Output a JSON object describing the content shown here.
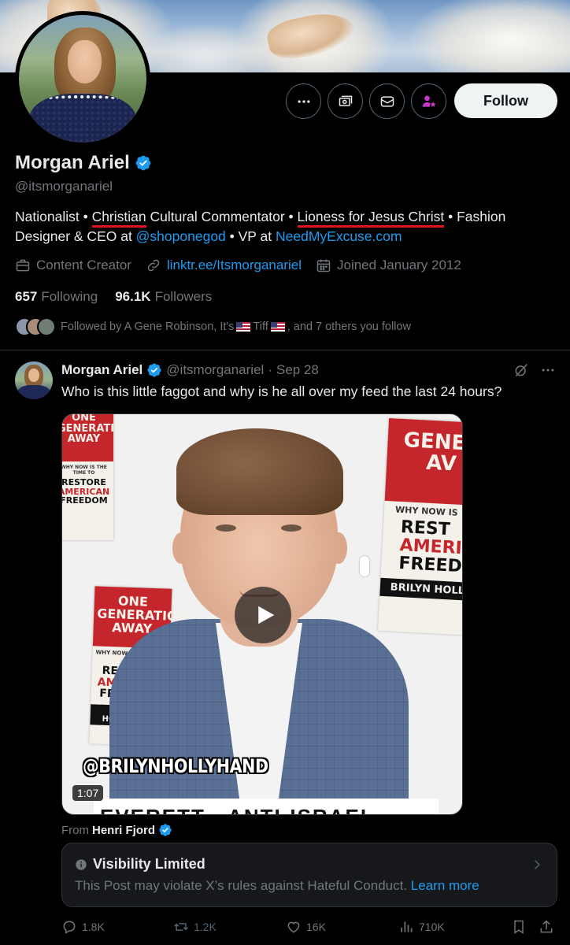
{
  "profile": {
    "display_name": "Morgan Ariel",
    "handle": "@itsmorganariel",
    "follow_label": "Follow",
    "bio": {
      "p1": "Nationalist • ",
      "p2": "Christian",
      "p3": " Cultural Commentator • ",
      "p4": "Lioness for Jesus Christ",
      "p5": " • Fashion Designer & CEO at ",
      "link1": "@shoponegod",
      "p6": " • VP at ",
      "link2": "NeedMyExcuse.com"
    },
    "category": "Content Creator",
    "website": "linktr.ee/Itsmorganariel",
    "joined": "Joined January 2012",
    "following_count": "657",
    "following_label": "Following",
    "followers_count": "96.1K",
    "followers_label": "Followers",
    "followed_by": {
      "prefix": "Followed by A Gene Robinson, It's",
      "middle": "Tiff",
      "suffix": ", and 7 others you follow"
    }
  },
  "tweet": {
    "name": "Morgan Ariel",
    "handle": "@itsmorganariel",
    "separator": "·",
    "date": "Sep 28",
    "text": "Who is this little faggot and why is he all over my feed the last 24 hours?",
    "media": {
      "overlay_handle": "@BRILYNHOLLYHAND",
      "duration": "1:07",
      "bottom_text": "EVERETT · ANTI-ISRAEL",
      "book": {
        "title_line1": "ONE",
        "title_line2": "GENERATION",
        "title_line3": "AWAY",
        "subtitle": "WHY NOW IS THE TIME TO",
        "mid1": "RESTORE",
        "mid2": "AMERICAN",
        "mid3": "FREEDOM",
        "author": "BRILYN HOLLYHAND"
      },
      "book_right": {
        "title": "GENE",
        "title2": "AV",
        "sub": "WHY NOW IS",
        "mid1": "REST",
        "mid2": "AMERI",
        "mid3": "FREED",
        "author": "BRILYN HOLL"
      }
    },
    "from_label": "From",
    "from_account": "Henri Fjord",
    "notice": {
      "title": "Visibility Limited",
      "body": "This Post may violate X’s rules against Hateful Conduct.",
      "link": "Learn more"
    },
    "stats": {
      "replies": "1.8K",
      "reposts": "1.2K",
      "likes": "16K",
      "views": "710K"
    }
  },
  "colors": {
    "accent": "#1d9bf0",
    "background": "#000000",
    "muted": "#71767b",
    "underline": "#e0141e",
    "subscribe": "#c936cc"
  },
  "icons": [
    "more-icon",
    "money-icon",
    "message-icon",
    "subscribe-icon",
    "verified-icon",
    "briefcase-icon",
    "link-icon",
    "calendar-icon",
    "grok-icon",
    "play-icon",
    "info-icon",
    "reply-icon",
    "repost-icon",
    "like-icon",
    "views-icon",
    "bookmark-icon",
    "share-icon"
  ]
}
